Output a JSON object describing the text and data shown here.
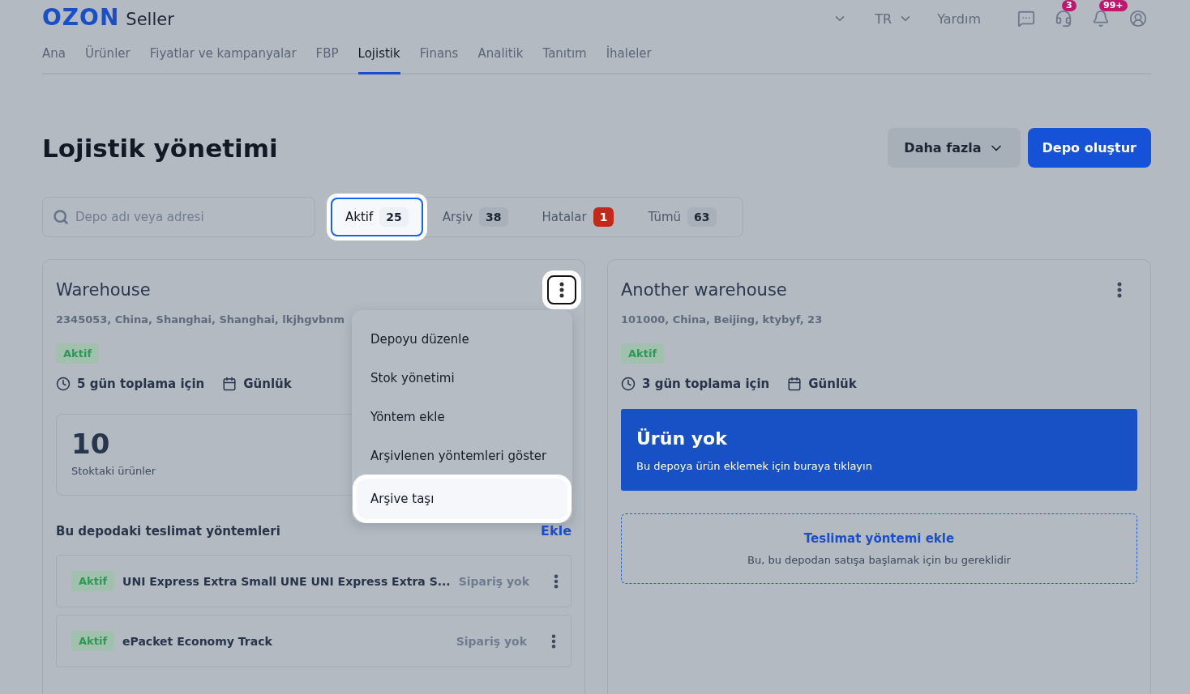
{
  "header": {
    "logo": {
      "brand": "OZON",
      "product": "Seller"
    },
    "language": "TR",
    "help": "Yardım",
    "icons": [
      {
        "kind": "chat"
      },
      {
        "kind": "support",
        "badge": "3"
      },
      {
        "kind": "bell",
        "badge": "99+"
      },
      {
        "kind": "user"
      }
    ]
  },
  "nav": [
    {
      "label": "Ana",
      "selected": false
    },
    {
      "label": "Ürünler",
      "selected": false
    },
    {
      "label": "Fiyatlar ve kampanyalar",
      "selected": false
    },
    {
      "label": "FBP",
      "selected": false
    },
    {
      "label": "Lojistik",
      "selected": true
    },
    {
      "label": "Finans",
      "selected": false
    },
    {
      "label": "Analitik",
      "selected": false
    },
    {
      "label": "Tanıtım",
      "selected": false
    },
    {
      "label": "İhaleler",
      "selected": false
    }
  ],
  "page": {
    "title": "Lojistik yönetimi",
    "more_button": "Daha fazla",
    "create_button": "Depo oluştur"
  },
  "search": {
    "placeholder": "Depo adı veya adresi"
  },
  "filters": [
    {
      "label": "Aktif",
      "count": "25",
      "kind": "neutral",
      "selected": true,
      "highlighted": true
    },
    {
      "label": "Arşiv",
      "count": "38",
      "kind": "neutral",
      "selected": false,
      "highlighted": false
    },
    {
      "label": "Hatalar",
      "count": "1",
      "kind": "error",
      "selected": false,
      "highlighted": false
    },
    {
      "label": "Tümü",
      "count": "63",
      "kind": "neutral",
      "selected": false,
      "highlighted": false
    }
  ],
  "warehouses": [
    {
      "name": "Warehouse",
      "address": "2345053, China, Shanghai, Shanghai, lkjhgvbnm",
      "status": "Aktif",
      "pickup": "5 gün toplama için",
      "schedule": "Günlük",
      "menu_highlighted": true,
      "menu": [
        {
          "label": "Depoyu düzenle",
          "highlighted": false
        },
        {
          "label": "Stok yönetimi",
          "highlighted": false
        },
        {
          "label": "Yöntem ekle",
          "highlighted": false
        },
        {
          "label": "Arşivlenen yöntemleri göster",
          "highlighted": false
        },
        {
          "label": "Arşive taşı",
          "highlighted": true
        }
      ],
      "stock": {
        "kind": "count",
        "value": "10",
        "caption": "Stoktaki ürünler"
      },
      "methods_title": "Bu depodaki teslimat yöntemleri",
      "methods_add": "Ekle",
      "methods": [
        {
          "status": "Aktif",
          "name": "UNI Express Extra Small UNE UNI Express Extra S...",
          "orders": "Sipariş yok"
        },
        {
          "status": "Aktif",
          "name": "ePacket Economy Track",
          "orders": "Sipariş yok"
        }
      ]
    },
    {
      "name": "Another warehouse",
      "address": "101000, China, Beijing, ktybyf, 23",
      "status": "Aktif",
      "pickup": "3 gün toplama için",
      "schedule": "Günlük",
      "menu_highlighted": false,
      "stock": {
        "kind": "empty",
        "value": "Ürün yok",
        "caption": "Bu depoya ürün eklemek için buraya tıklayın"
      },
      "add_method": {
        "title": "Teslimat yöntemi ekle",
        "caption": "Bu, bu depodan satışa başlamak için bu gereklidir"
      }
    }
  ]
}
